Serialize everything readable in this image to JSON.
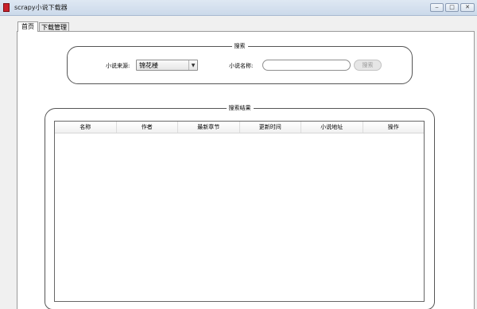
{
  "window": {
    "title": "scrapy小说下载器",
    "minimize_glyph": "‒",
    "maximize_glyph": "□",
    "close_glyph": "✕"
  },
  "tabs": [
    {
      "label": "首页",
      "active": true
    },
    {
      "label": "下载管理",
      "active": false
    }
  ],
  "search_group": {
    "title": "搜索",
    "source_label": "小说来源:",
    "source_selected": "锦花楼",
    "name_label": "小说名称:",
    "name_value": "",
    "name_placeholder": "",
    "search_button": "搜索"
  },
  "results_group": {
    "title": "搜索结果",
    "columns": [
      "名称",
      "作者",
      "最新章节",
      "更新时间",
      "小说地址",
      "操作"
    ],
    "rows": []
  },
  "icons": {
    "app": "app-book-icon",
    "dropdown": "chevron-down-icon"
  },
  "colors": {
    "app_icon": "#c8202b",
    "titlebar": "#d4e0ee"
  }
}
